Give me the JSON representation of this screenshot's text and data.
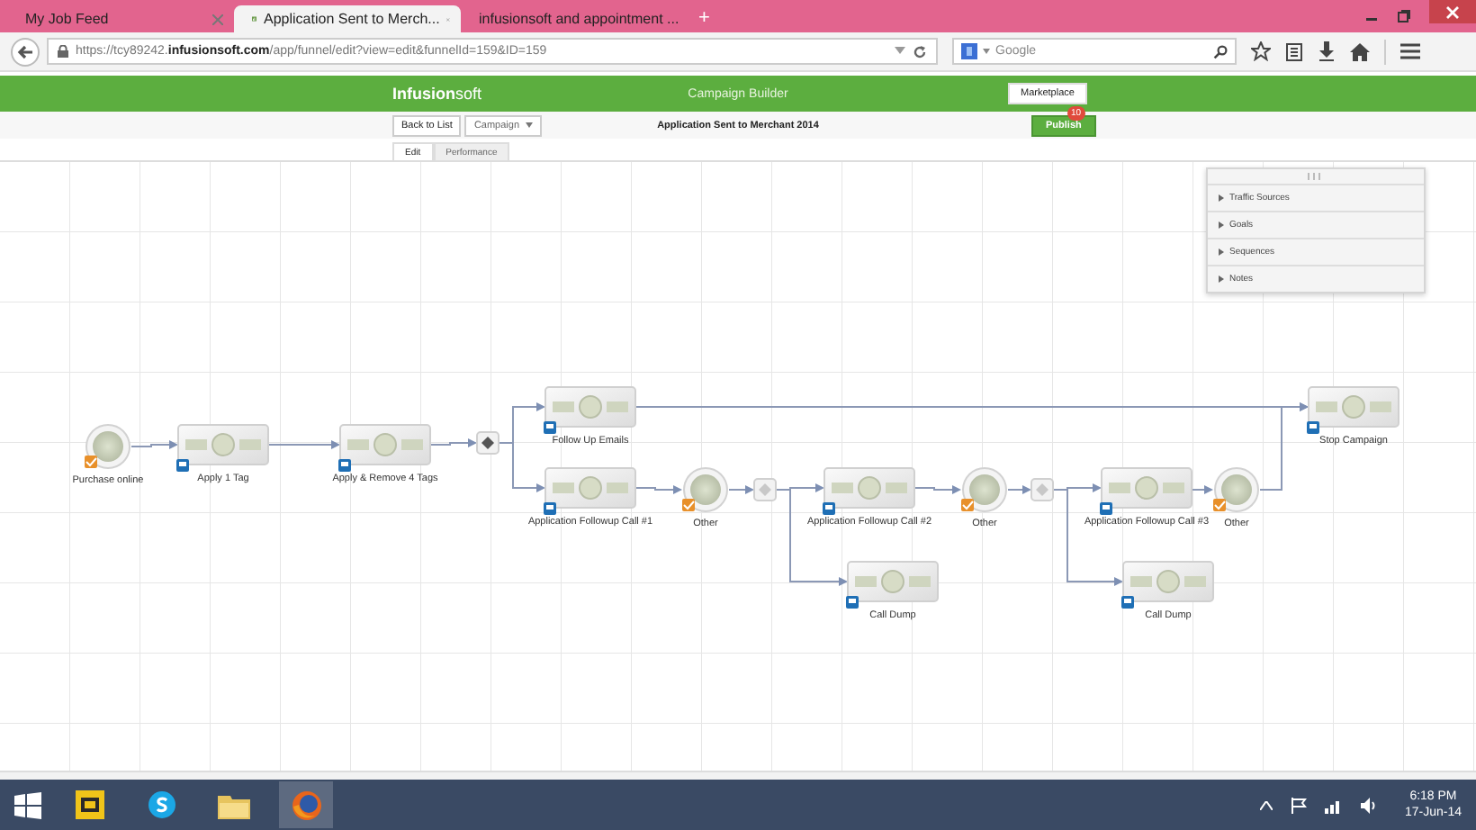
{
  "browser": {
    "tabs": [
      {
        "title": "My Job Feed",
        "selected": false
      },
      {
        "title": "Application Sent to Merch...",
        "selected": true
      },
      {
        "title": "infusionsoft and appointment ...",
        "selected": false
      }
    ],
    "new_tab": "+",
    "url": "https://tcy89242.**infusionsoft.com**/app/funnel/edit?view=edit&funnelId=159&ID=159",
    "search": {
      "placeholder": "Google"
    }
  },
  "app": {
    "logo": "**Infusion**soft",
    "title": "Campaign Builder",
    "marketplace": "Marketplace"
  },
  "toolbar": {
    "back": "Back to List",
    "campaign": "Campaign",
    "name": "Application Sent to Merchant 2014",
    "publish": "Publish",
    "badge": "10"
  },
  "tabs": [
    {
      "label": "Edit",
      "selected": true
    },
    {
      "label": "Performance",
      "selected": false
    }
  ],
  "panel": {
    "items": [
      "Traffic Sources",
      "Goals",
      "Sequences",
      "Notes"
    ]
  },
  "nodes": [
    {
      "kind": "goal",
      "label": "Purchase online"
    },
    {
      "kind": "sequence",
      "label": "Apply 1 Tag"
    },
    {
      "kind": "sequence",
      "label": "Apply & Remove 4 Tags"
    },
    {
      "kind": "junction"
    },
    {
      "kind": "sequence",
      "label": "Follow Up Emails"
    },
    {
      "kind": "sequence",
      "label": "Application Followup Call #1"
    },
    {
      "kind": "goal",
      "label": "Other"
    },
    {
      "kind": "junction"
    },
    {
      "kind": "sequence",
      "label": "Application Followup Call #2"
    },
    {
      "kind": "sequence",
      "label": "Call Dump"
    },
    {
      "kind": "goal",
      "label": "Other"
    },
    {
      "kind": "junction"
    },
    {
      "kind": "sequence",
      "label": "Application Followup Call #3"
    },
    {
      "kind": "sequence",
      "label": "Call Dump"
    },
    {
      "kind": "goal",
      "label": "Other"
    },
    {
      "kind": "sequence",
      "label": "Stop Campaign"
    }
  ],
  "taskbar": {
    "time": "6:18 PM",
    "date": "17-Jun-14"
  }
}
